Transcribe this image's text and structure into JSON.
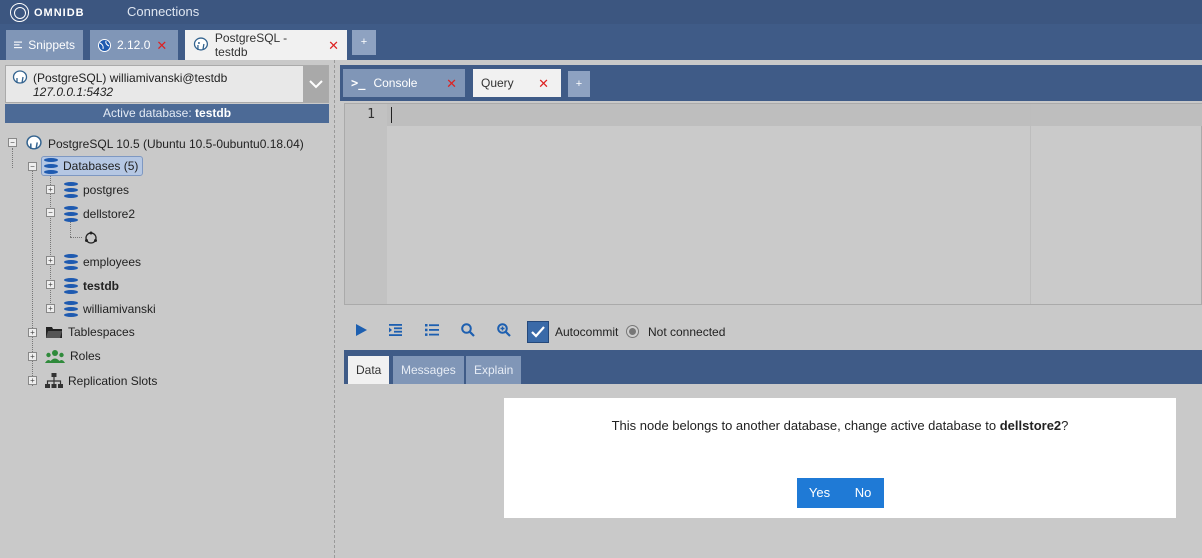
{
  "app": {
    "logo_text": "OMNIDB",
    "nav_connections": "Connections"
  },
  "outer_tabs": [
    {
      "label": "Snippets",
      "icon": "list-icon",
      "closable": false,
      "active": false
    },
    {
      "label": "2.12.0",
      "icon": "globe-icon",
      "closable": true,
      "active": false
    },
    {
      "label": "PostgreSQL - testdb",
      "icon": "postgresql-icon",
      "closable": true,
      "active": true
    }
  ],
  "outer_tab_add": "+",
  "connection": {
    "line1": "(PostgreSQL) williamivanski@testdb",
    "line2": "127.0.0.1:5432",
    "active_db_prefix": "Active database: ",
    "active_db_name": "testdb"
  },
  "tree": {
    "server": "PostgreSQL 10.5 (Ubuntu 10.5-0ubuntu0.18.04)",
    "databases_label": "Databases (5)",
    "databases": [
      "postgres",
      "dellstore2",
      "employees",
      "testdb",
      "williamivanski"
    ],
    "tablespaces": "Tablespaces",
    "roles": "Roles",
    "replication_slots": "Replication Slots"
  },
  "inner_tabs": [
    {
      "label": "Console",
      "icon": "terminal-icon",
      "active": false
    },
    {
      "label": "Query",
      "active": true
    }
  ],
  "inner_tab_add": "+",
  "editor": {
    "line_number": "1"
  },
  "toolbar": {
    "autocommit_label": "Autocommit",
    "status_label": "Not connected"
  },
  "result_tabs": [
    "Data",
    "Messages",
    "Explain"
  ],
  "dialog": {
    "message_prefix": "This node belongs to another database, change active database to ",
    "message_db": "dellstore2",
    "message_suffix": "?",
    "yes_label": "Yes",
    "no_label": "No"
  },
  "colors": {
    "accent": "#3f5b87",
    "button": "#1f7ad6",
    "close": "#dd2222"
  }
}
